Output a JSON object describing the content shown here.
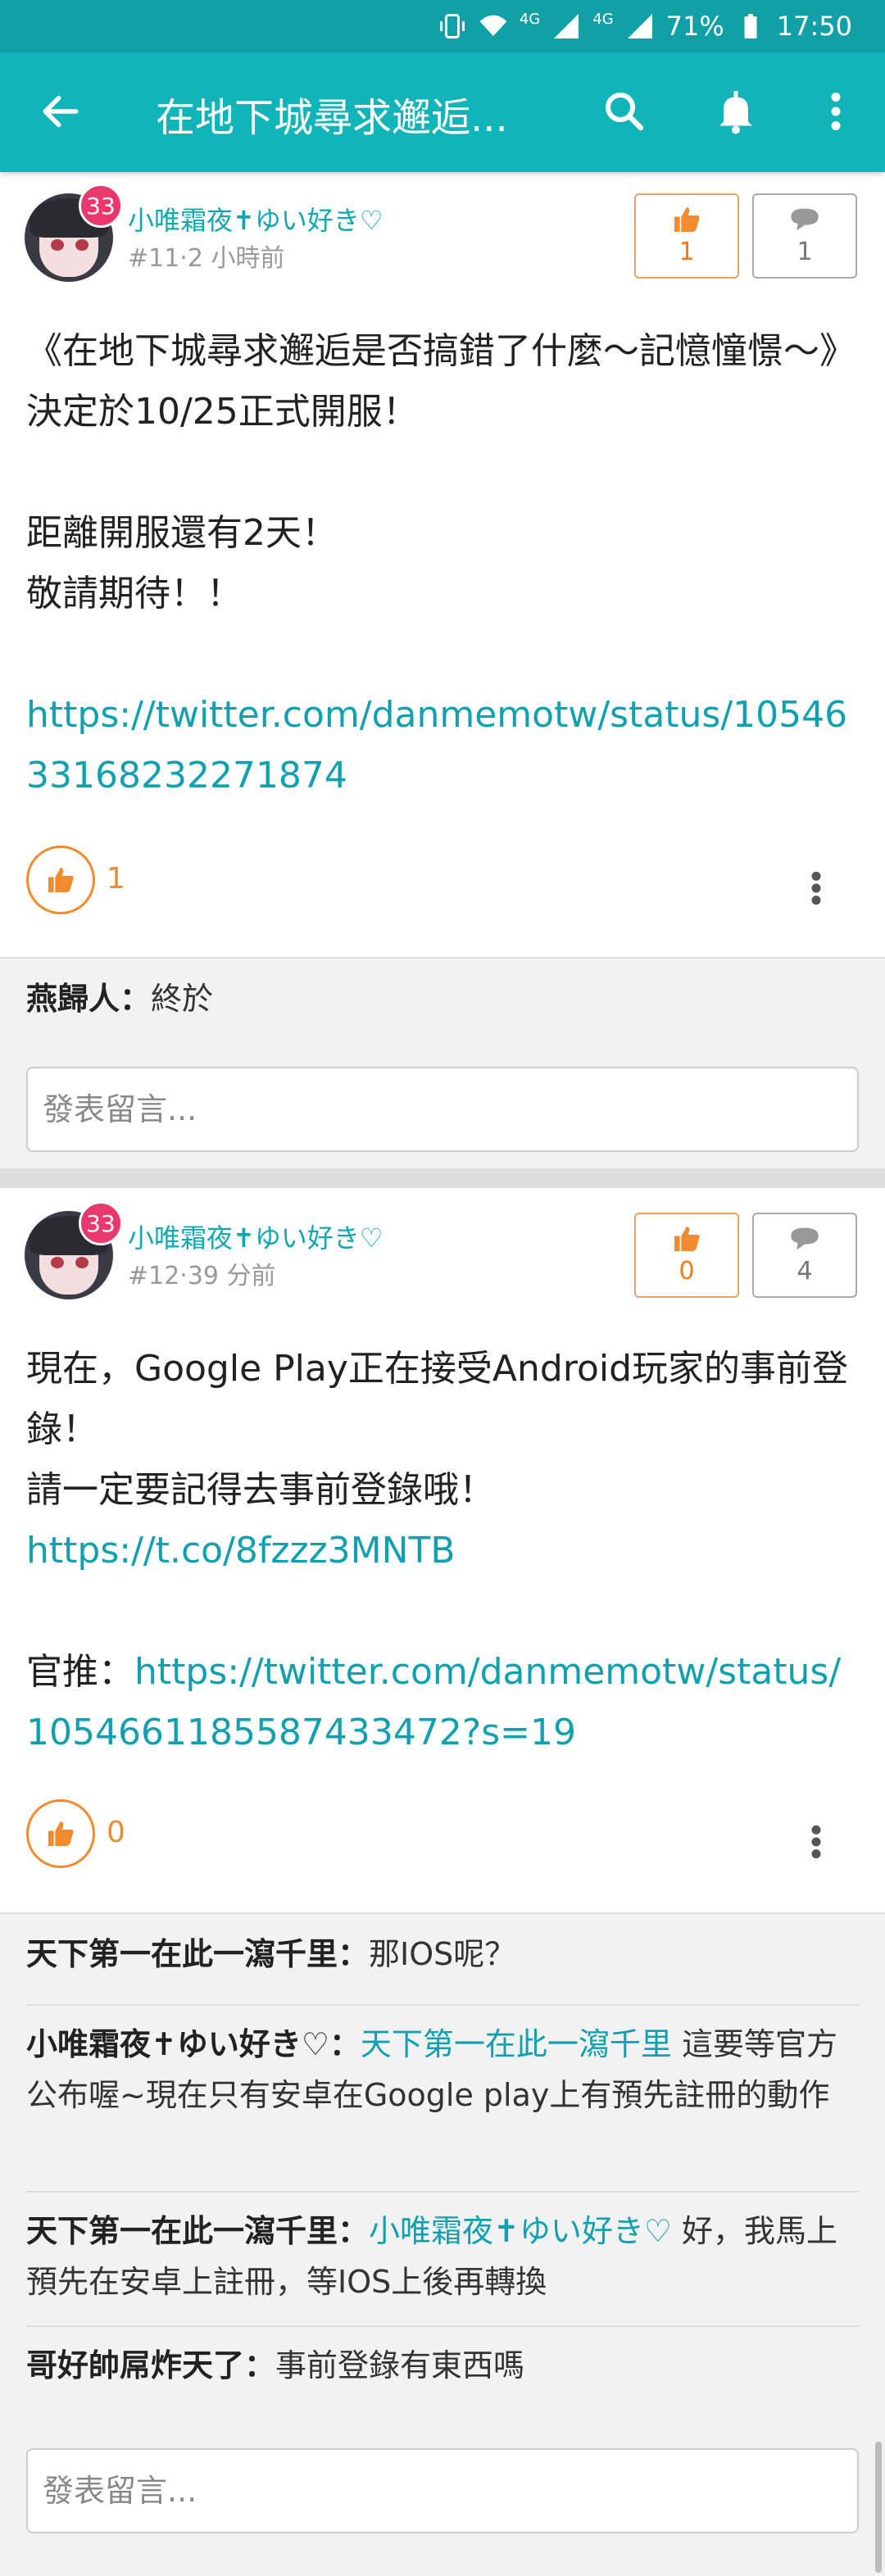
{
  "status": {
    "battery": "71%",
    "time": "17:50",
    "net1": "4G",
    "net2": "4G"
  },
  "appbar": {
    "title": "在地下城尋求邂逅..."
  },
  "reply_placeholder": "發表留言...",
  "posts": [
    {
      "author": "小唯霜夜✝ゆい好き♡",
      "level": "33",
      "meta": "#11‧2 小時前",
      "gp": "1",
      "bp": "1",
      "content_text": "《在地下城尋求邂逅是否搞錯了什麼～記憶憧憬～》決定於10/25正式開服！\n\n距離開服還有2天！\n敬請期待！！\n\n",
      "content_link": "https://twitter.com/danmemotw/status/1054633168232271874",
      "likes": "1",
      "comments": [
        {
          "name": "燕歸人：",
          "text": "終於"
        }
      ]
    },
    {
      "author": "小唯霜夜✝ゆい好き♡",
      "level": "33",
      "meta": "#12‧39 分前",
      "gp": "0",
      "bp": "4",
      "content_text": "現在，Google Play正在接受Android玩家的事前登錄！\n請一定要記得去事前登錄哦！\n",
      "content_link": "https://t.co/8fzzz3MNTB",
      "content_text2": "\n\n官推：",
      "content_link2": "https://twitter.com/danmemotw/status/1054661185587433472?s=19",
      "likes": "0",
      "comments": [
        {
          "name": "天下第一在此一瀉千里：",
          "text": "那IOS呢？"
        },
        {
          "name": "小唯霜夜✝ゆい好き♡：",
          "mention": "天下第一在此一瀉千里",
          "text": " 這要等官方公布喔~現在只有安卓在Google play上有預先註冊的動作"
        },
        {
          "name": "天下第一在此一瀉千里：",
          "mention": "小唯霜夜✝ゆい好き♡",
          "text": " 好，我馬上預先在安卓上註冊，等IOS上後再轉換"
        },
        {
          "name": "哥好帥屌炸天了：",
          "text": "事前登錄有東西嗎"
        }
      ]
    }
  ],
  "colors": {
    "accent": "#10b4b9",
    "gp": "#f28a2e",
    "level_badge": "#e8386c"
  }
}
